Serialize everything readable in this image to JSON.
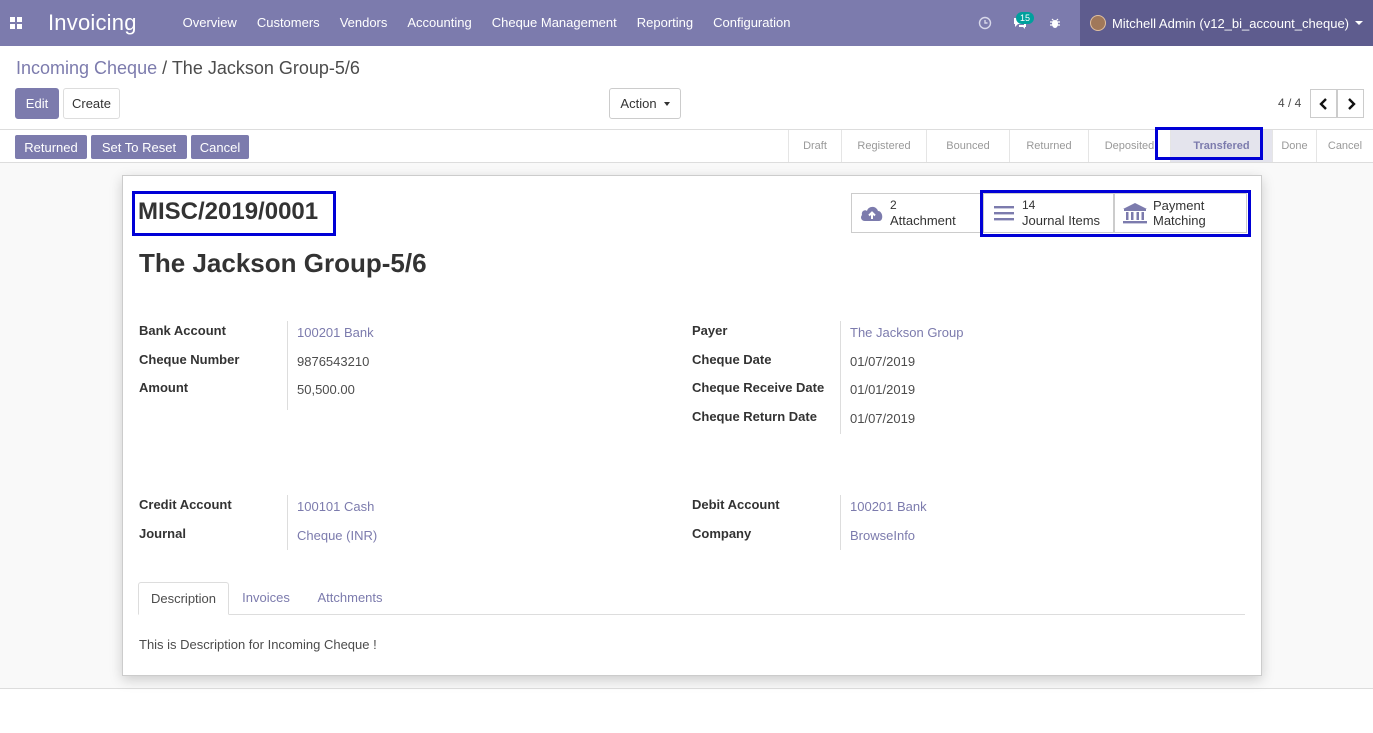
{
  "app": {
    "name": "Invoicing",
    "grid_icon": "apps-grid-icon"
  },
  "menu": [
    "Overview",
    "Customers",
    "Vendors",
    "Accounting",
    "Cheque Management",
    "Reporting",
    "Configuration"
  ],
  "systray": {
    "messages_count": "15",
    "user_name": "Mitchell Admin (v12_bi_account_cheque)"
  },
  "breadcrumb": {
    "parent": "Incoming Cheque",
    "separator": "/",
    "current": "The Jackson Group-5/6"
  },
  "control": {
    "edit": "Edit",
    "create": "Create",
    "action": "Action",
    "pager": "4 / 4"
  },
  "status_buttons": [
    "Returned",
    "Set To Reset",
    "Cancel"
  ],
  "stages": [
    "Draft",
    "Registered",
    "Bounced",
    "Returned",
    "Deposited",
    "Transfered",
    "Done",
    "Cancel"
  ],
  "active_stage": "Transfered",
  "smart_buttons": {
    "attachment": {
      "count": "2",
      "label": "Attachment"
    },
    "journal": {
      "count": "14",
      "label": "Journal Items"
    },
    "payment": {
      "line1": "Payment",
      "line2": "Matching"
    }
  },
  "record": {
    "reference": "MISC/2019/0001",
    "title": "The Jackson Group-5/6"
  },
  "fields": {
    "bank_account": {
      "label": "Bank Account",
      "value": "100201 Bank"
    },
    "cheque_number": {
      "label": "Cheque Number",
      "value": "9876543210"
    },
    "amount": {
      "label": "Amount",
      "value": "50,500.00"
    },
    "payer": {
      "label": "Payer",
      "value": "The Jackson Group"
    },
    "cheque_date": {
      "label": "Cheque Date",
      "value": "01/07/2019"
    },
    "cheque_receive_date": {
      "label": "Cheque Receive Date",
      "value": "01/01/2019"
    },
    "cheque_return_date": {
      "label": "Cheque Return Date",
      "value": "01/07/2019"
    },
    "credit_account": {
      "label": "Credit Account",
      "value": "100101 Cash"
    },
    "journal": {
      "label": "Journal",
      "value": "Cheque (INR)"
    },
    "debit_account": {
      "label": "Debit Account",
      "value": "100201 Bank"
    },
    "company": {
      "label": "Company",
      "value": "BrowseInfo"
    }
  },
  "tabs": [
    "Description",
    "Invoices",
    "Attchments"
  ],
  "description_text": "This is Description for Incoming Cheque !",
  "colors": {
    "brand": "#7c7bad",
    "highlight": "#0000d6",
    "badge": "#00a09d"
  }
}
